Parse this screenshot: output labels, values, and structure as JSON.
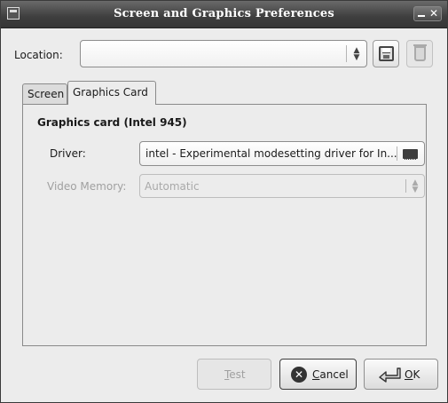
{
  "window": {
    "title": "Screen and Graphics Preferences"
  },
  "location": {
    "label": "Location:",
    "value": "",
    "icons": [
      "save-icon",
      "delete-icon"
    ]
  },
  "tabs": [
    {
      "label": "Screen",
      "selected": false
    },
    {
      "label": "Graphics Card",
      "selected": true
    }
  ],
  "graphics_card": {
    "section_title": "Graphics card (Intel 945)",
    "driver_label": "Driver:",
    "driver_value": "intel - Experimental modesetting driver for In...",
    "video_memory_label": "Video Memory:",
    "video_memory_value": "Automatic",
    "video_memory_enabled": false
  },
  "buttons": {
    "test_prefix": "",
    "test_mnemonic": "T",
    "test_rest": "est",
    "test_enabled": false,
    "cancel_mnemonic": "C",
    "cancel_rest": "ancel",
    "ok_mnemonic": "O",
    "ok_rest": "K"
  }
}
